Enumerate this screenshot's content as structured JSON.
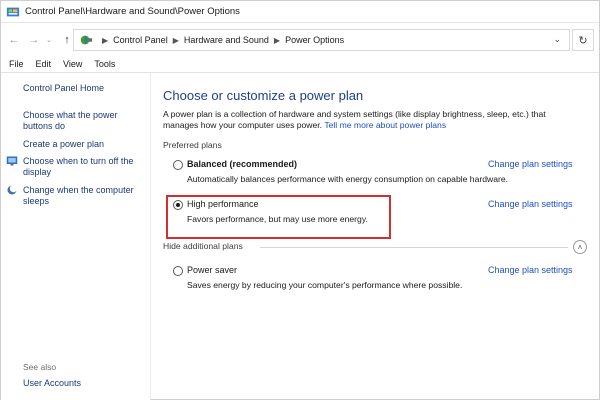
{
  "window": {
    "title": "Control Panel\\Hardware and Sound\\Power Options"
  },
  "address_bar": {
    "breadcrumbs": [
      "Control Panel",
      "Hardware and Sound",
      "Power Options"
    ],
    "dropdown_icon": "chevron-down-icon",
    "refresh_icon": "refresh-icon"
  },
  "menu": [
    "File",
    "Edit",
    "View",
    "Tools"
  ],
  "sidebar": {
    "home": "Control Panel Home",
    "links": [
      "Choose what the power buttons do",
      "Create a power plan",
      "Choose when to turn off the display",
      "Change when the computer sleeps"
    ],
    "see_also_label": "See also",
    "see_also_links": [
      "User Accounts"
    ]
  },
  "main": {
    "title": "Choose or customize a power plan",
    "description": "A power plan is a collection of hardware and system settings (like display brightness, sleep, etc.) that manages how your computer uses power.",
    "description_link": "Tell me more about power plans",
    "preferred_plans_label": "Preferred plans",
    "plans": [
      {
        "name": "Balanced (recommended)",
        "description": "Automatically balances performance with energy consumption on capable hardware.",
        "change_link": "Change plan settings",
        "selected": false
      },
      {
        "name": "High performance",
        "description": "Favors performance, but may use more energy.",
        "change_link": "Change plan settings",
        "selected": true
      }
    ],
    "hide_additional_label": "Hide additional plans",
    "additional_plans": [
      {
        "name": "Power saver",
        "description": "Saves energy by reducing your computer's performance where possible.",
        "change_link": "Change plan settings",
        "selected": false
      }
    ]
  },
  "colors": {
    "title_blue": "#1c3f8c",
    "link_blue": "#1e4fc4",
    "highlight_red": "#d32f2f"
  }
}
